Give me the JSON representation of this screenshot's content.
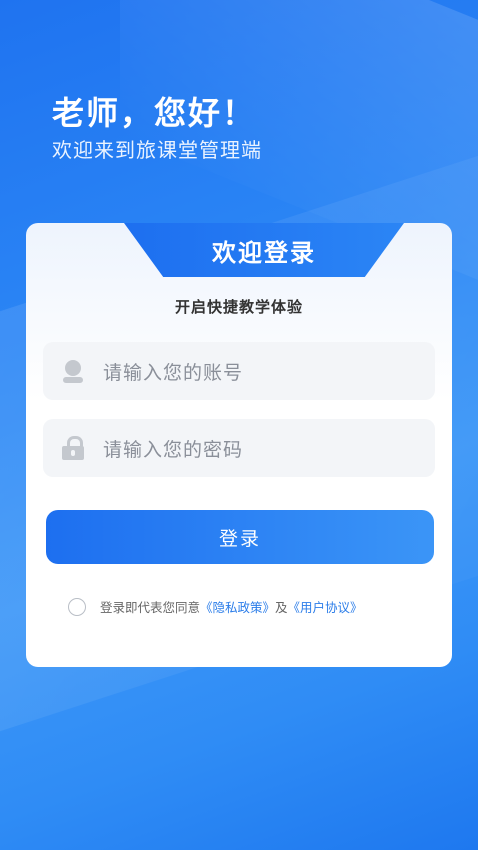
{
  "header": {
    "greeting": "老师，您好！",
    "subtitle": "欢迎来到旅课堂管理端"
  },
  "card": {
    "tab_title": "欢迎登录",
    "tagline": "开启快捷教学体验",
    "account_placeholder": "请输入您的账号",
    "password_placeholder": "请输入您的密码",
    "login_label": "登录",
    "agreement": {
      "prefix": "登录即代表您同意",
      "privacy_link": "《隐私政策》",
      "and": "及",
      "terms_link": "《用户协议》"
    }
  },
  "colors": {
    "primary": "#1d6ff0",
    "link": "#2b7de9"
  },
  "icons": {
    "account": "user-icon",
    "password": "lock-icon"
  }
}
